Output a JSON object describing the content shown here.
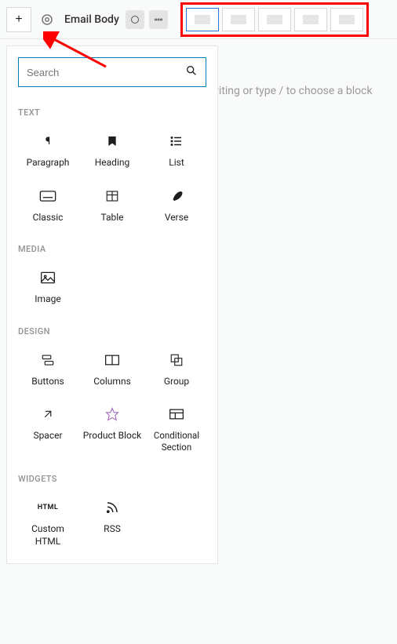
{
  "toolbar": {
    "title": "Email Body"
  },
  "body_placeholder": "Start writing or type / to choose a block",
  "search": {
    "placeholder": "Search"
  },
  "categories": {
    "text": {
      "label": "TEXT",
      "blocks": [
        {
          "name": "paragraph",
          "label": "Paragraph"
        },
        {
          "name": "heading",
          "label": "Heading"
        },
        {
          "name": "list",
          "label": "List"
        },
        {
          "name": "classic",
          "label": "Classic"
        },
        {
          "name": "table",
          "label": "Table"
        },
        {
          "name": "verse",
          "label": "Verse"
        }
      ]
    },
    "media": {
      "label": "MEDIA",
      "blocks": [
        {
          "name": "image",
          "label": "Image"
        }
      ]
    },
    "design": {
      "label": "DESIGN",
      "blocks": [
        {
          "name": "buttons",
          "label": "Buttons"
        },
        {
          "name": "columns",
          "label": "Columns"
        },
        {
          "name": "group",
          "label": "Group"
        },
        {
          "name": "spacer",
          "label": "Spacer"
        },
        {
          "name": "product-block",
          "label": "Product Block"
        },
        {
          "name": "conditional-section",
          "label": "Conditional Section"
        }
      ]
    },
    "widgets": {
      "label": "WIDGETS",
      "blocks": [
        {
          "name": "custom-html",
          "label": "Custom HTML"
        },
        {
          "name": "rss",
          "label": "RSS"
        }
      ]
    }
  }
}
